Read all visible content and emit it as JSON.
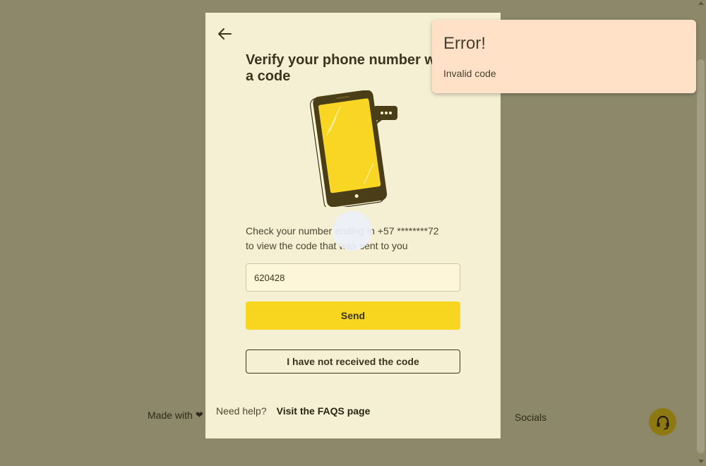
{
  "background": {
    "footer_left": "Made with",
    "footer_right": "Socials"
  },
  "modal": {
    "title": "Verify your phone number with a code",
    "description_line1": "Check your number ending in +57 ********72",
    "description_line2": "to view the code that was sent to you",
    "code_input_value": "620428",
    "send_label": "Send",
    "resend_label": "I have not received the code",
    "help_text": "Need help?",
    "help_link": "Visit the FAQS page"
  },
  "toast": {
    "title": "Error!",
    "message": "Invalid code"
  },
  "colors": {
    "overlay": "#8c8869",
    "modal_bg": "#f5efd3",
    "accent_yellow": "#f8d51e",
    "toast_bg": "#fee1c7",
    "support_button": "#8d7811"
  },
  "icons": {
    "back": "arrow-left-icon",
    "heart": "heart-icon",
    "support": "headset-icon",
    "chat": "chat-bubble-icon"
  }
}
